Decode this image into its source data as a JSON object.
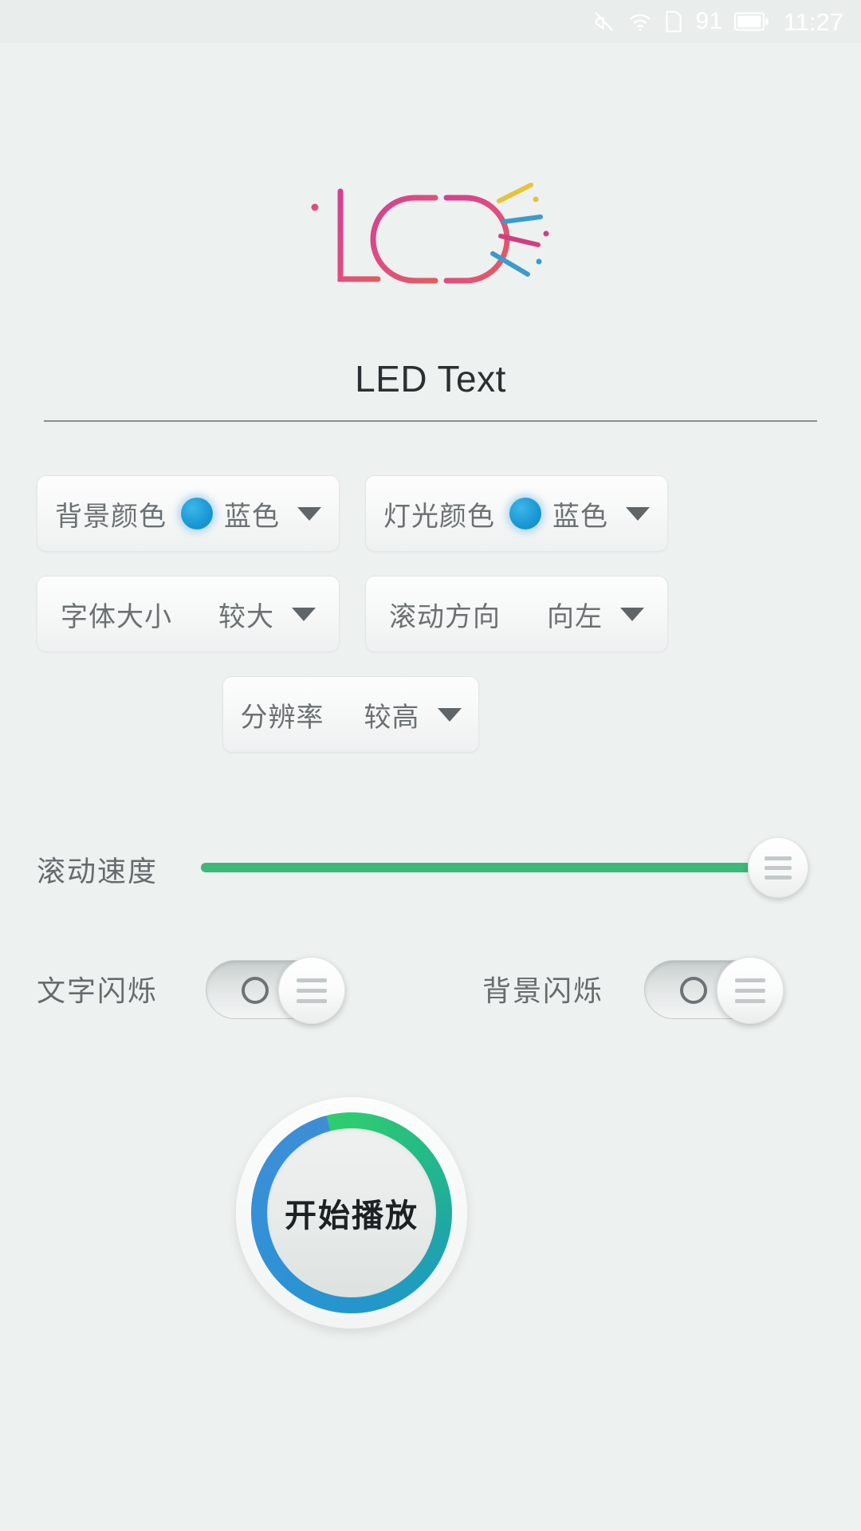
{
  "status_bar": {
    "mute_icon": "mute-icon",
    "wifi_icon": "wifi-icon",
    "sim_icon": "sim-card-icon",
    "battery_percent": "91",
    "battery_icon": "battery-icon",
    "time": "11:27"
  },
  "brand": {
    "logo_text": "iLED",
    "logo_color_start": "#d94a90",
    "logo_color_end": "#e05a63",
    "ray_pink": "#d1407f",
    "ray_blue": "#3a9bd0",
    "ray_yellow": "#e8c23a"
  },
  "header": {
    "title": "LED Text"
  },
  "settings": [
    {
      "label": "背景颜色",
      "value": "蓝色",
      "swatch": "#1b9ad6",
      "has_swatch": true
    },
    {
      "label": "灯光颜色",
      "value": "蓝色",
      "swatch": "#1b9ad6",
      "has_swatch": true
    },
    {
      "label": "字体大小",
      "value": "较大",
      "has_swatch": false
    },
    {
      "label": "滚动方向",
      "value": "向左",
      "has_swatch": false
    },
    {
      "label": "分辨率",
      "value": "较高",
      "has_swatch": false
    }
  ],
  "slider": {
    "label": "滚动速度",
    "percent": 100,
    "fill_color": "#3cb878",
    "thumb_icon": "grip-handle-icon"
  },
  "toggles": [
    {
      "label": "文字闪烁",
      "state": "off",
      "knob_icon": "grip-handle-icon",
      "off_icon": "circle-icon"
    },
    {
      "label": "背景闪烁",
      "state": "off",
      "knob_icon": "grip-handle-icon",
      "off_icon": "circle-icon"
    }
  ],
  "play_button": {
    "label": "开始播放",
    "ring_color_green": "#2ecc71",
    "ring_color_blue": "#3a8fd6"
  }
}
